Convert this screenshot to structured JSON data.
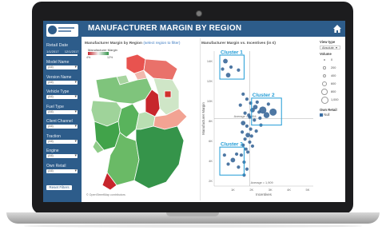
{
  "dashboard": {
    "title": "MANUFACTURER MARGIN BY REGION",
    "logo_text": "Sales Region Analysis"
  },
  "filters": {
    "retail_date_label": "Retail Date",
    "date_start": "1/1/2017",
    "date_end": "12/1/2017",
    "items": [
      {
        "label": "Model Name",
        "value": "(All)"
      },
      {
        "label": "Version Name",
        "value": "(All)"
      },
      {
        "label": "Vehicle Type",
        "value": "(All)"
      },
      {
        "label": "Fuel Type",
        "value": "(All)"
      },
      {
        "label": "Client Channel",
        "value": "(All)"
      },
      {
        "label": "Traction",
        "value": "(All)"
      },
      {
        "label": "Engine",
        "value": "(All)"
      },
      {
        "label": "Own Retail",
        "value": "(All)"
      }
    ],
    "reset_label": "Reset Filters"
  },
  "map": {
    "title": "Manufacturer Margin by Region",
    "subtitle": "(select region to filter)",
    "legend_title": "Manufacturer Margin",
    "legend_min": "4%",
    "legend_max": "12%",
    "credit": "© OpenStreetMap contributors"
  },
  "scatter": {
    "title": "Manufacturer Margin vs. Incentives (in €)",
    "clusters": [
      "Cluster 1",
      "Cluster 2",
      "Cluster 3"
    ],
    "avg_margin_label": "Average = 8.264",
    "avg_incentive_label": "Average = 1,909",
    "cluster_color": "#1f9bd6"
  },
  "legend": {
    "view_type_label": "View type",
    "view_type_value": "Absolute",
    "volume_label": "Volume",
    "volume_values": [
      "0",
      "200",
      "400",
      "600",
      "800",
      "1,000"
    ],
    "own_retail_label": "Own Retail",
    "own_retail_value": "Null"
  },
  "chart_data": {
    "type": "scatter",
    "title": "Manufacturer Margin vs. Incentives (in €)",
    "xlabel": "Incentives",
    "ylabel": "Manufacturer Margin",
    "x_ticks": [
      "1K",
      "2K",
      "3K",
      "4K",
      "5K"
    ],
    "y_ticks": [
      "2K",
      "4K",
      "6K",
      "8K",
      "10K",
      "12K",
      "14K"
    ],
    "xlim": [
      0,
      5.3
    ],
    "ylim": [
      1.5,
      15
    ],
    "grid": false,
    "reference_lines": {
      "avg_margin": 8.264,
      "avg_incentive": 1.909
    },
    "cluster_regions": [
      {
        "name": "Cluster 1",
        "x": [
          0.3,
          1.6
        ],
        "y": [
          12.2,
          14.6
        ]
      },
      {
        "name": "Cluster 2",
        "x": [
          2.0,
          3.6
        ],
        "y": [
          7.6,
          10.3
        ]
      },
      {
        "name": "Cluster 3",
        "x": [
          0.3,
          1.6
        ],
        "y": [
          2.6,
          5.4
        ]
      }
    ],
    "points": [
      [
        0.6,
        14.0,
        2
      ],
      [
        0.9,
        13.4,
        1
      ],
      [
        0.75,
        12.6,
        2
      ],
      [
        1.3,
        13.1,
        1
      ],
      [
        0.45,
        13.2,
        1
      ],
      [
        2.2,
        9.4,
        2
      ],
      [
        2.4,
        8.9,
        1
      ],
      [
        2.6,
        9.1,
        4
      ],
      [
        2.8,
        8.6,
        3
      ],
      [
        3.15,
        8.9,
        4
      ],
      [
        2.45,
        8.3,
        1
      ],
      [
        2.3,
        9.9,
        1
      ],
      [
        2.9,
        9.7,
        1
      ],
      [
        1.55,
        10.7,
        1
      ],
      [
        1.75,
        10.2,
        1
      ],
      [
        1.95,
        9.8,
        1
      ],
      [
        2.05,
        9.1,
        2
      ],
      [
        1.85,
        8.6,
        1
      ],
      [
        1.65,
        8.8,
        1
      ],
      [
        2.15,
        8.1,
        1
      ],
      [
        1.55,
        7.8,
        2
      ],
      [
        1.75,
        7.5,
        1
      ],
      [
        1.95,
        7.2,
        1
      ],
      [
        1.5,
        6.9,
        1
      ],
      [
        1.8,
        6.6,
        2
      ],
      [
        2.0,
        6.5,
        1
      ],
      [
        1.65,
        6.2,
        1
      ],
      [
        1.9,
        5.9,
        1
      ],
      [
        1.55,
        5.6,
        1
      ],
      [
        1.7,
        5.2,
        1
      ],
      [
        2.05,
        5.5,
        1
      ],
      [
        1.8,
        4.9,
        1
      ],
      [
        1.45,
        4.6,
        1
      ],
      [
        1.0,
        4.1,
        2
      ],
      [
        0.75,
        3.7,
        1
      ],
      [
        1.3,
        3.4,
        1
      ],
      [
        0.55,
        4.6,
        1
      ],
      [
        1.2,
        4.7,
        1
      ],
      [
        1.6,
        3.9,
        1
      ],
      [
        1.75,
        3.2,
        1
      ],
      [
        1.6,
        2.6,
        1
      ],
      [
        1.9,
        8.4,
        1
      ],
      [
        2.25,
        7.0,
        1
      ],
      [
        2.5,
        7.6,
        1
      ],
      [
        1.4,
        9.6,
        1
      ]
    ]
  }
}
